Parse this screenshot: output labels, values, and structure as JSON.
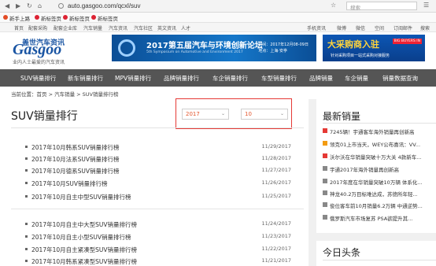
{
  "browser": {
    "url": "auto.gasgoo.com/qcxl/suv",
    "search_placeholder": "搜索"
  },
  "bookmarks": [
    "新手上路",
    "新标签页",
    "新标签页",
    "新标签页"
  ],
  "topbar": {
    "left": [
      "首页",
      "配套采购",
      "配套企业库",
      "汽车销量",
      "汽车资讯",
      "汽车社区",
      "英文资讯",
      "人才"
    ],
    "right": [
      "手机资讯",
      "微博",
      "微信",
      "空间",
      "订阅邮件",
      "搜索"
    ]
  },
  "header": {
    "logo_cn": "盖世汽车资讯",
    "logo_en": "Gasgoo",
    "logo_slogan": "业内人士最爱的汽车资讯",
    "banner1_title": "2017第五届汽车与环境创新论坛",
    "banner1_sub": "5th Symposium on Automotive and Environment 2017",
    "banner1_date": "时间：2017年12月08-09日",
    "banner1_place": "地点：上海·安亭",
    "banner2_title": "大采购商入驻",
    "banner2_tag": "BIG BUYERS IN",
    "banner2_sub": "针对采购项目一站式采购对接服务"
  },
  "mainnav": [
    "SUV销量排行",
    "新车销量排行",
    "MPV销量排行",
    "品牌销量排行",
    "车企销量排行",
    "车型销量排行",
    "品牌销量",
    "车企销量",
    "销量数据查询"
  ],
  "breadcrumb": "当前位置：首页 > 汽车销量 > SUV销量排行榜",
  "page_title": "SUV销量排行",
  "filters": {
    "year": "2017",
    "month": "10"
  },
  "articles": [
    {
      "title": "2017年10月韩系SUV销量排行榜",
      "date": "11/29/2017"
    },
    {
      "title": "2017年10月法系SUV销量排行榜",
      "date": "11/28/2017"
    },
    {
      "title": "2017年10月德系SUV销量排行榜",
      "date": "11/27/2017"
    },
    {
      "title": "2017年10月SUV销量排行榜",
      "date": "11/26/2017"
    },
    {
      "title": "2017年10月自主中型SUV销量排行榜",
      "date": "11/25/2017"
    },
    {
      "title": "2017年10月自主中大型SUV销量排行榜",
      "date": "11/24/2017"
    },
    {
      "title": "2017年10月自主小型SUV销量排行榜",
      "date": "11/23/2017"
    },
    {
      "title": "2017年10月自主紧凑型SUV销量排行榜",
      "date": "11/22/2017"
    },
    {
      "title": "2017年10月韩系紧凑型SUV销量排行榜",
      "date": "11/21/2017"
    }
  ],
  "sidebar": {
    "latest_title": "最新销量",
    "latest": [
      {
        "text": "7245辆！宇通客车海外销量再创新高",
        "color": "#e53935"
      },
      {
        "text": "领克01上市当天，WEY公布喜讯：VV...",
        "color": "#f39c12"
      },
      {
        "text": "沃尔沃在华销量突破十万大关 4款新车...",
        "color": "#e53935"
      },
      {
        "text": "宇通2017年海外销量再创新高",
        "color": "#888888"
      },
      {
        "text": "2017年度在华销量突破10万辆 体系化...",
        "color": "#888888"
      },
      {
        "text": "神龙40.2万目标难达成，苏德所年轻...",
        "color": "#888888"
      },
      {
        "text": "俊位客车前10月销量6.2万辆 中通逆势...",
        "color": "#888888"
      },
      {
        "text": "俄罗斯汽车市场复苏 PSA欲提升其...",
        "color": "#888888"
      }
    ],
    "today_title": "今日头条"
  }
}
